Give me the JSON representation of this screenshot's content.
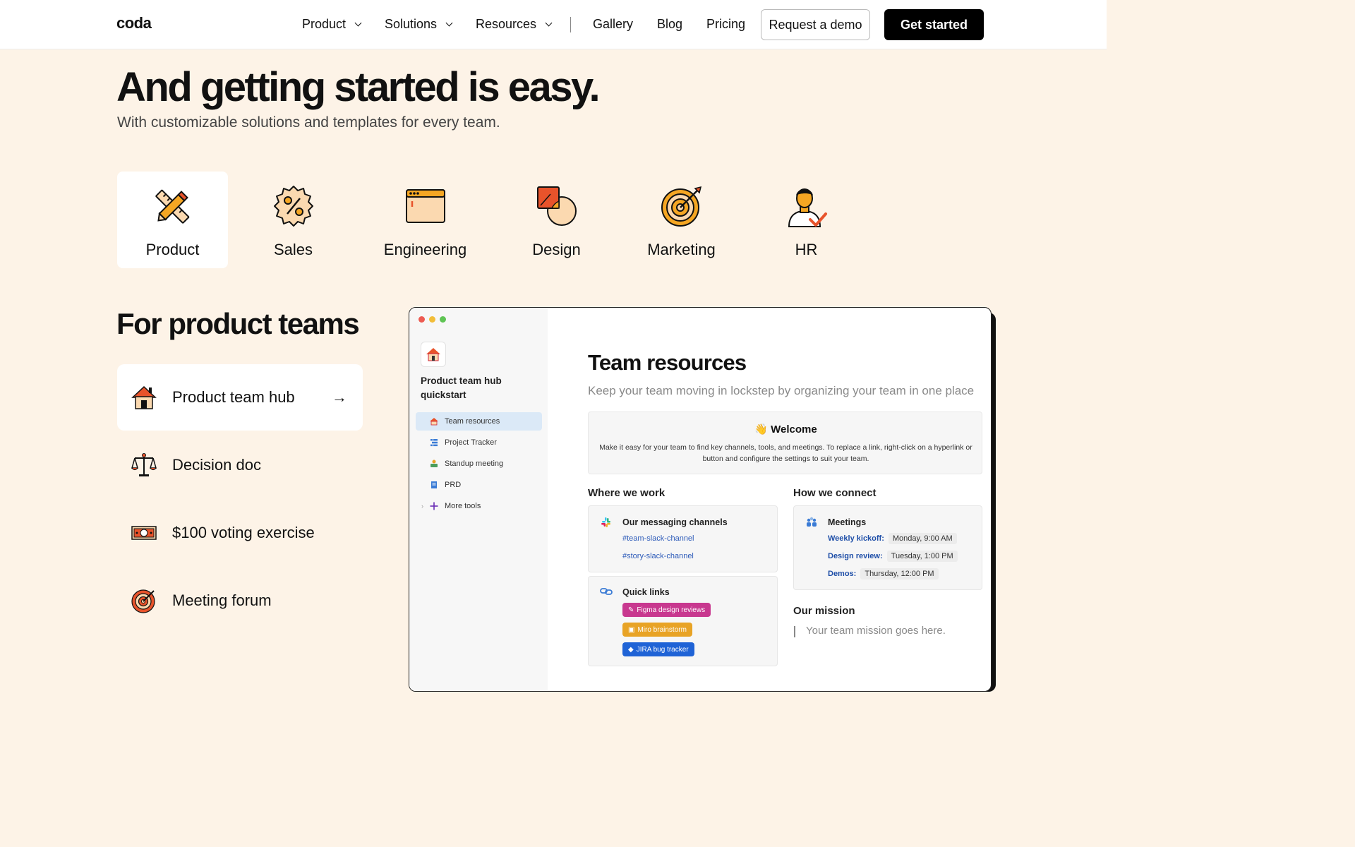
{
  "nav": {
    "logo": "coda",
    "items": [
      {
        "label": "Product",
        "dropdown": true
      },
      {
        "label": "Solutions",
        "dropdown": true
      },
      {
        "label": "Resources",
        "dropdown": true
      },
      {
        "label": "Gallery",
        "dropdown": false
      },
      {
        "label": "Blog",
        "dropdown": false
      },
      {
        "label": "Pricing",
        "dropdown": false
      }
    ],
    "demo_label": "Request a demo",
    "start_label": "Get started"
  },
  "hero": {
    "title": "And getting started is easy.",
    "subtitle": "With customizable solutions and templates for every team."
  },
  "categories": [
    {
      "label": "Product",
      "icon": "pencil-ruler-icon",
      "active": true
    },
    {
      "label": "Sales",
      "icon": "percent-badge-icon",
      "active": false
    },
    {
      "label": "Engineering",
      "icon": "browser-window-icon",
      "active": false
    },
    {
      "label": "Design",
      "icon": "shapes-icon",
      "active": false
    },
    {
      "label": "Marketing",
      "icon": "target-icon",
      "active": false
    },
    {
      "label": "HR",
      "icon": "person-check-icon",
      "active": false
    }
  ],
  "section": {
    "title": "For product teams",
    "templates": [
      {
        "label": "Product team hub",
        "icon": "house-icon",
        "active": true
      },
      {
        "label": "Decision doc",
        "icon": "scales-icon",
        "active": false
      },
      {
        "label": "$100 voting exercise",
        "icon": "dollar-bill-icon",
        "active": false
      },
      {
        "label": "Meeting forum",
        "icon": "target-icon",
        "active": false
      }
    ]
  },
  "doc": {
    "sidebar_title": "Product team hub quickstart",
    "pages": [
      {
        "label": "Team resources",
        "icon": "house-icon",
        "selected": true
      },
      {
        "label": "Project Tracker",
        "icon": "list-icon",
        "selected": false
      },
      {
        "label": "Standup meeting",
        "icon": "people-icon",
        "selected": false
      },
      {
        "label": "PRD",
        "icon": "document-icon",
        "selected": false
      },
      {
        "label": "More tools",
        "icon": "plus-icon",
        "selected": false
      }
    ],
    "title": "Team resources",
    "subtitle": "Keep your team moving in lockstep by organizing your team in one place",
    "welcome_title": "👋 Welcome",
    "welcome_body": "Make it easy for your team to find key channels, tools, and meetings. To replace a link, right-click on a hyperlink or button and configure the settings to suit your team.",
    "where_heading": "Where we work",
    "connect_heading": "How we connect",
    "channels_title": "Our messaging channels",
    "channels": [
      "#team-slack-channel",
      "#story-slack-channel"
    ],
    "quicklinks_title": "Quick links",
    "quicklinks": [
      {
        "label": "Figma design reviews",
        "color": "#c8388f"
      },
      {
        "label": "Miro brainstorm",
        "color": "#e8a325"
      },
      {
        "label": "JIRA bug tracker",
        "color": "#1f63d6"
      }
    ],
    "meetings_title": "Meetings",
    "meetings": [
      {
        "name": "Weekly kickoff:",
        "time": "Monday, 9:00 AM"
      },
      {
        "name": "Design review:",
        "time": "Tuesday, 1:00 PM"
      },
      {
        "name": "Demos:",
        "time": "Thursday, 12:00 PM"
      }
    ],
    "mission_heading": "Our mission",
    "mission_placeholder": "Your team mission goes here."
  },
  "colors": {
    "background": "#fdf3e7",
    "accent_orange": "#e8532b",
    "accent_peach": "#fbd9b0"
  }
}
